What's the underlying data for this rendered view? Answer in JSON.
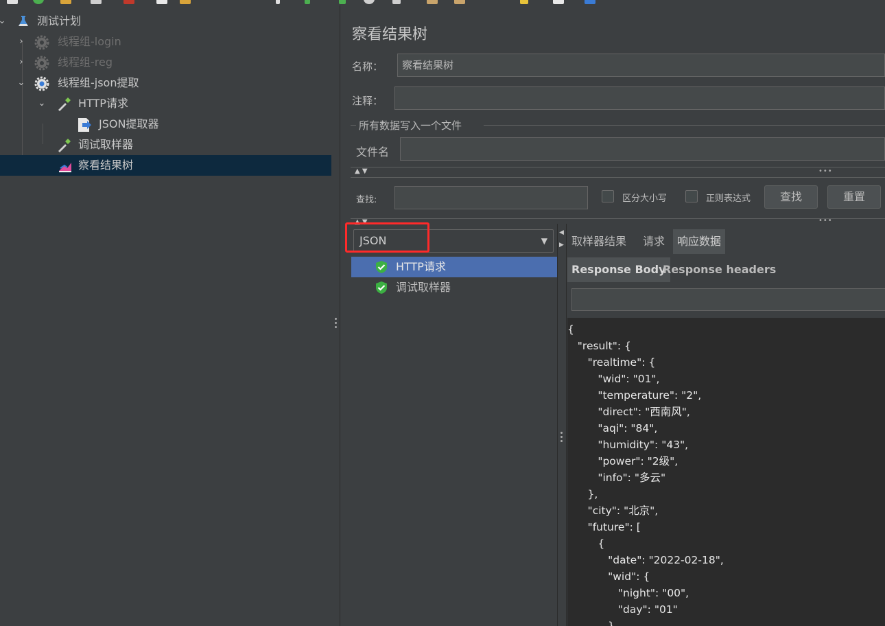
{
  "tree": {
    "items": [
      {
        "label": "测试计划"
      },
      {
        "label": "线程组-login"
      },
      {
        "label": "线程组-reg"
      },
      {
        "label": "线程组-json提取"
      },
      {
        "label": "HTTP请求"
      },
      {
        "label": "JSON提取器"
      },
      {
        "label": "调试取样器"
      },
      {
        "label": "察看结果树"
      }
    ]
  },
  "panel": {
    "title": "察看结果树",
    "name_label": "名称：",
    "name_value": "察看结果树",
    "comment_label": "注释：",
    "comment_value": "",
    "file_section_label": "所有数据写入一个文件",
    "filename_label": "文件名",
    "filename_value": ""
  },
  "search": {
    "label": "查找:",
    "value": "",
    "case_sensitive_label": "区分大小写",
    "regex_label": "正则表达式",
    "find_button": "查找",
    "reset_button": "重置"
  },
  "renderer": {
    "selected": "JSON"
  },
  "results": [
    {
      "label": "HTTP请求",
      "status": "success"
    },
    {
      "label": "调试取样器",
      "status": "success"
    }
  ],
  "tabs": [
    {
      "label": "取样器结果"
    },
    {
      "label": "请求"
    },
    {
      "label": "响应数据"
    }
  ],
  "subtabs": [
    {
      "label": "Response Body"
    },
    {
      "label": "Response headers"
    }
  ],
  "response_lines": [
    "{",
    "   \"result\": {",
    "      \"realtime\": {",
    "         \"wid\": \"01\",",
    "         \"temperature\": \"2\",",
    "         \"direct\": \"西南风\",",
    "         \"aqi\": \"84\",",
    "         \"humidity\": \"43\",",
    "         \"power\": \"2级\",",
    "         \"info\": \"多云\"",
    "      },",
    "      \"city\": \"北京\",",
    "      \"future\": [",
    "         {",
    "            \"date\": \"2022-02-18\",",
    "            \"wid\": {",
    "               \"night\": \"00\",",
    "               \"day\": \"01\"",
    "            }"
  ],
  "colors": {
    "background": "#3c3f41",
    "selection_tree": "#0d293e",
    "selection_list": "#4b6eaf",
    "highlight": "#ff2a2a",
    "success": "#3cb043"
  }
}
